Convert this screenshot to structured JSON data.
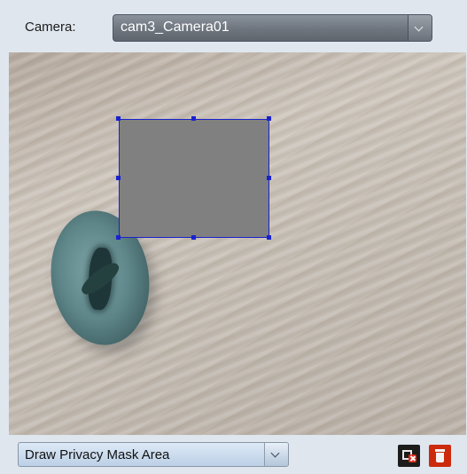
{
  "header": {
    "camera_label": "Camera:",
    "camera_value": "cam3_Camera01"
  },
  "footer": {
    "mode_value": "Draw Privacy Mask Area",
    "clear_icon": "clear-area-icon",
    "delete_icon": "delete-trash-icon"
  },
  "colors": {
    "mask_fill": "#808080",
    "mask_border": "#1a22cc",
    "delete_button": "#cc2a0c"
  }
}
